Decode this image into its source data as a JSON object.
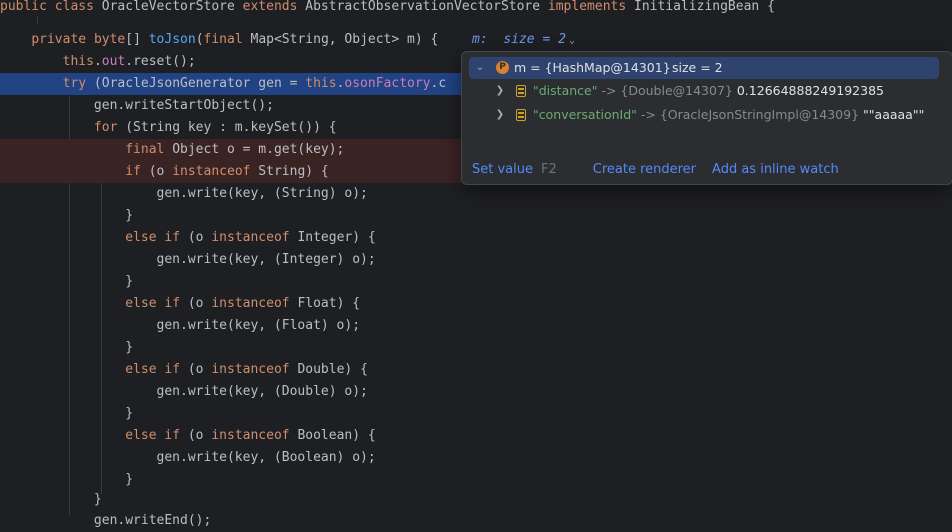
{
  "code": {
    "line0": {
      "t1": "public",
      "t2": " ",
      "t3": "class",
      "t4": " OracleVectorStore ",
      "t5": "extends",
      "t6": " AbstractObservationVectorStore ",
      "t7": "implements",
      "t8": " InitializingBean {"
    },
    "line1": {
      "t1": "    ",
      "t2": "private",
      "t3": " ",
      "t4": "byte",
      "t5": "[] ",
      "t6": "toJson",
      "t7": "(",
      "t8": "final",
      "t9": " Map<String, Object> m) {"
    },
    "line2": {
      "t1": "        ",
      "t2": "this",
      "t3": ".",
      "t4": "out",
      "t5": ".reset();"
    },
    "line3": {
      "t1": "        ",
      "t2": "try",
      "t3": " (OracleJsonGenerator gen = ",
      "t4": "this",
      "t5": ".",
      "t6": "osonFactory",
      "t7": ".c"
    },
    "line4": {
      "t1": "            gen.writeStartObject();"
    },
    "line5": {
      "t1": "            ",
      "t2": "for",
      "t3": " (String key : m.keySet()) {"
    },
    "line6": {
      "t1": "                ",
      "t2": "final",
      "t3": " Object o = m.get(key);"
    },
    "line7": {
      "t1": "                ",
      "t2": "if",
      "t3": " (o ",
      "t4": "instanceof",
      "t5": " String) {"
    },
    "line8": {
      "t1": "                    gen.write(key, (String) o);"
    },
    "line9": {
      "t1": "                }"
    },
    "line10": {
      "t1": "                ",
      "t2": "else if",
      "t3": " (o ",
      "t4": "instanceof",
      "t5": " Integer) {"
    },
    "line11": {
      "t1": "                    gen.write(key, (Integer) o);"
    },
    "line12": {
      "t1": "                }"
    },
    "line13": {
      "t1": "                ",
      "t2": "else if",
      "t3": " (o ",
      "t4": "instanceof",
      "t5": " Float) {"
    },
    "line14": {
      "t1": "                    gen.write(key, (Float) o);"
    },
    "line15": {
      "t1": "                }"
    },
    "line16": {
      "t1": "                ",
      "t2": "else if",
      "t3": " (o ",
      "t4": "instanceof",
      "t5": " Double) {"
    },
    "line17": {
      "t1": "                    gen.write(key, (Double) o);"
    },
    "line18": {
      "t1": "                }"
    },
    "line19": {
      "t1": "                ",
      "t2": "else if",
      "t3": " (o ",
      "t4": "instanceof",
      "t5": " Boolean) {"
    },
    "line20": {
      "t1": "                    gen.write(key, (Boolean) o);"
    },
    "line21": {
      "t1": "                }"
    },
    "line22": {
      "t1": "            }"
    },
    "line23": {
      "t1": "            gen.writeEnd();"
    }
  },
  "inline_hint": {
    "name": "m:",
    "value": "size = 2"
  },
  "popup": {
    "root": {
      "badge": "P",
      "text": "m = {HashMap@14301}",
      "size": "size = 2"
    },
    "entries": [
      {
        "key": "\"distance\"",
        "arrow": " -> ",
        "type": "{Double@14307}",
        "value": "0.12664888249192385"
      },
      {
        "key": "\"conversationId\"",
        "arrow": " -> ",
        "type": "{OracleJsonStringImpl@14309}",
        "value": "\"\"aaaaa\"\""
      }
    ],
    "actions": {
      "set_value": "Set value",
      "set_value_key": "F2",
      "create_renderer": "Create renderer",
      "add_watch": "Add as inline watch"
    }
  },
  "colors": {
    "background": "#1e1f22",
    "highlight": "#214283",
    "breakpoint": "#3a2323",
    "keyword": "#cf8e6d",
    "method": "#56a8f5",
    "field": "#c77dbb",
    "link": "#548af7"
  }
}
